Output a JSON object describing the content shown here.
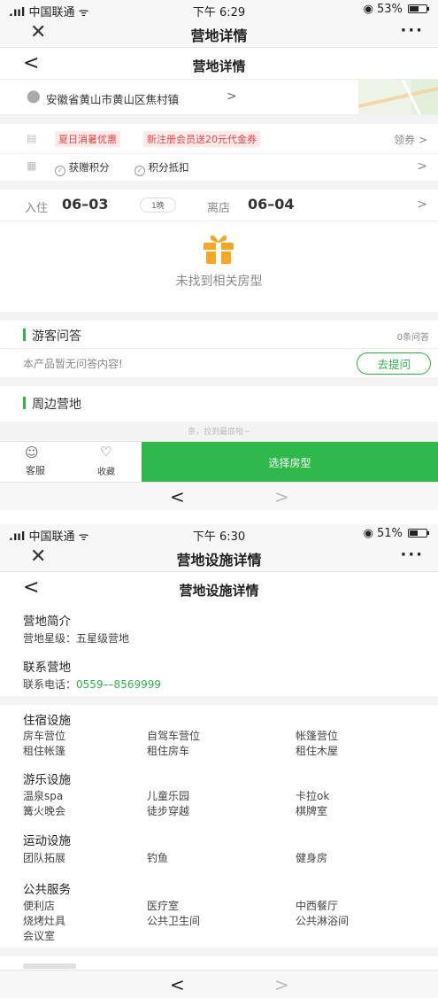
{
  "screen1": {
    "status": {
      "carrier": "中国联通",
      "time": "下午 6:29",
      "battery": "53%",
      "battery_level": 0.53
    },
    "nav": {
      "close": "✕",
      "title": "营地详情",
      "more": "···"
    },
    "header": {
      "back": "<",
      "title": "营地详情"
    },
    "location": {
      "address": "安徽省黄山市黄山区焦村镇",
      "arrow": ">"
    },
    "promo": {
      "tag1": "夏日消暑优惠",
      "tag2": "新注册会员送20元代金券",
      "action": "领券 >"
    },
    "points": {
      "earn": "获赠积分",
      "deduct": "积分抵扣",
      "arrow": ">"
    },
    "dates": {
      "checkin_label": "入住",
      "checkin": "06–03",
      "nights": "1晚",
      "checkout_label": "离店",
      "checkout": "06–04",
      "arrow": ">"
    },
    "empty": {
      "text": "未找到相关房型"
    },
    "qa": {
      "title": "游客问答",
      "count": "0条问答",
      "empty": "本产品暂无问答内容!",
      "ask": "去提问"
    },
    "nearby": {
      "title": "周边营地",
      "bottom_hint": "亲，拉到最底啦~"
    },
    "actions": {
      "service": "客服",
      "favorite": "收藏",
      "select": "选择房型"
    },
    "browser": {
      "back": "<",
      "forward": ">"
    }
  },
  "screen2": {
    "status": {
      "carrier": "中国联通",
      "time": "下午 6:30",
      "battery": "51%",
      "battery_level": 0.51
    },
    "nav": {
      "close": "✕",
      "title": "营地设施详情",
      "more": "···"
    },
    "header": {
      "back": "<",
      "title": "营地设施详情"
    },
    "intro": {
      "title": "营地简介",
      "rating_label": "营地星级：",
      "rating": "五星级营地"
    },
    "contact": {
      "title": "联系营地",
      "phone_label": "联系电话：",
      "phone": "0559––8569999"
    },
    "lodging": {
      "title": "住宿设施",
      "items": [
        "房车营位",
        "自驾车营位",
        "帐篷营位",
        "租住帐篷",
        "租住房车",
        "租住木屋"
      ]
    },
    "recreation": {
      "title": "游乐设施",
      "items": [
        "温泉spa",
        "儿童乐园",
        "卡拉ok",
        "篝火晚会",
        "徒步穿越",
        "棋牌室"
      ]
    },
    "sports": {
      "title": "运动设施",
      "items": [
        "团队拓展",
        "钓鱼",
        "健身房"
      ]
    },
    "public": {
      "title": "公共服务",
      "items": [
        "便利店",
        "医疗室",
        "中西餐厅",
        "烧烤灶具",
        "公共卫生间",
        "公共淋浴间",
        "会议室"
      ]
    },
    "browser": {
      "back": "<",
      "forward": ">"
    }
  },
  "colors": {
    "accent": "#30b14a",
    "promo": "#e64343",
    "divider": "#f3f3f3"
  }
}
